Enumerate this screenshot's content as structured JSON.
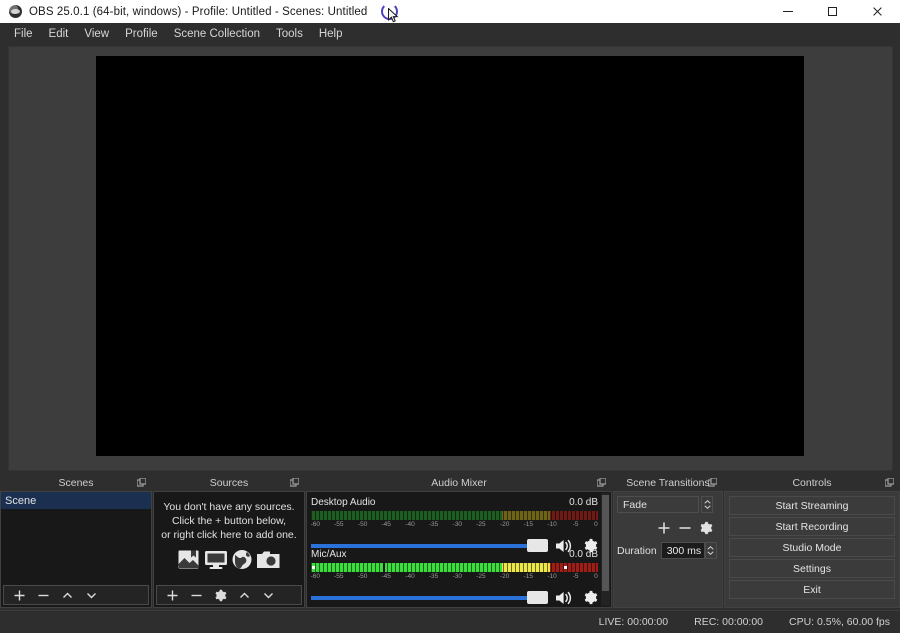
{
  "titlebar": {
    "title": "OBS 25.0.1 (64-bit, windows) - Profile: Untitled - Scenes: Untitled",
    "logo_icon": "obs-logo-icon",
    "spinner_icon": "loading-spinner-icon",
    "cursor_icon": "mouse-cursor-icon",
    "minimize_icon": "minimize-icon",
    "maximize_icon": "maximize-icon",
    "close_icon": "close-icon"
  },
  "menubar": {
    "items": [
      {
        "label": "File"
      },
      {
        "label": "Edit"
      },
      {
        "label": "View"
      },
      {
        "label": "Profile"
      },
      {
        "label": "Scene Collection"
      },
      {
        "label": "Tools"
      },
      {
        "label": "Help"
      }
    ]
  },
  "preview": {
    "canvas_color": "#000000",
    "background_color": "#3d3d3d"
  },
  "scenes": {
    "title": "Scenes",
    "float_icon": "undock-icon",
    "items": [
      {
        "label": "Scene",
        "selected": true
      }
    ],
    "toolbar": [
      {
        "icon": "plus-icon",
        "glyph": "+"
      },
      {
        "icon": "minus-icon",
        "glyph": "−"
      },
      {
        "icon": "chevron-up-icon",
        "glyph": "⌃"
      },
      {
        "icon": "chevron-down-icon",
        "glyph": "⌄"
      }
    ]
  },
  "sources": {
    "title": "Sources",
    "float_icon": "undock-icon",
    "empty_lines": [
      "You don't have any sources.",
      "Click the + button below,",
      "or right click here to add one."
    ],
    "empty_icons": [
      "image-source-icon",
      "display-capture-icon",
      "browser-source-icon",
      "camera-source-icon"
    ],
    "toolbar": [
      {
        "icon": "plus-icon",
        "glyph": "+"
      },
      {
        "icon": "minus-icon",
        "glyph": "−"
      },
      {
        "icon": "gear-icon",
        "glyph": "gear"
      },
      {
        "icon": "chevron-up-icon",
        "glyph": "⌃"
      },
      {
        "icon": "chevron-down-icon",
        "glyph": "⌄"
      }
    ]
  },
  "mixer": {
    "title": "Audio Mixer",
    "float_icon": "undock-icon",
    "scale_labels": [
      "-60",
      "-55",
      "-50",
      "-45",
      "-40",
      "-35",
      "-30",
      "-25",
      "-20",
      "-15",
      "-10",
      "-5",
      "0"
    ],
    "channels": [
      {
        "name": "Desktop Audio",
        "db": "0.0 dB",
        "active": false,
        "level_pct": 0,
        "peak_pct": null,
        "volume_pct": 100,
        "mute_icon": "speaker-icon",
        "settings_icon": "gear-icon"
      },
      {
        "name": "Mic/Aux",
        "db": "0.0 dB",
        "active": true,
        "level_pct": 100,
        "peak_pct": 25,
        "volume_pct": 100,
        "mute_icon": "speaker-icon",
        "settings_icon": "gear-icon"
      }
    ]
  },
  "transitions": {
    "title": "Scene Transitions",
    "float_icon": "undock-icon",
    "selected": "Fade",
    "duration_label": "Duration",
    "duration_value": "300 ms",
    "tools": [
      {
        "icon": "plus-icon",
        "glyph": "+"
      },
      {
        "icon": "minus-icon",
        "glyph": "−"
      },
      {
        "icon": "gear-icon",
        "glyph": "gear"
      }
    ]
  },
  "controls": {
    "title": "Controls",
    "float_icon": "undock-icon",
    "buttons": [
      {
        "label": "Start Streaming"
      },
      {
        "label": "Start Recording"
      },
      {
        "label": "Studio Mode"
      },
      {
        "label": "Settings"
      },
      {
        "label": "Exit"
      }
    ]
  },
  "statusbar": {
    "live": "LIVE: 00:00:00",
    "rec": "REC: 00:00:00",
    "cpu": "CPU: 0.5%, 60.00 fps"
  },
  "colors": {
    "accent_blue": "#2b72d8",
    "selection": "#1b3050",
    "meter_green": "#3ddb3d",
    "meter_yellow": "#ece84a",
    "meter_red": "#9d2018",
    "spinner": "#4b3fc4"
  }
}
